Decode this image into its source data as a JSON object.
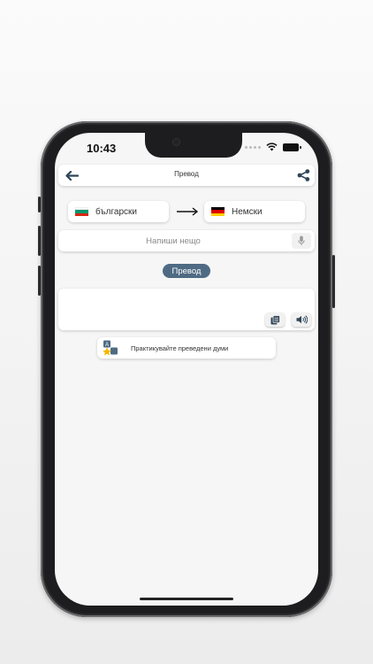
{
  "status_bar": {
    "time": "10:43",
    "icons": [
      "signal-dots-icon",
      "wifi-icon",
      "battery-icon"
    ]
  },
  "toolbar": {
    "title": "Превод",
    "back_icon": "arrow-left-icon",
    "share_icon": "share-icon"
  },
  "languages": {
    "source": {
      "name": "български",
      "flag": "bulgaria-flag-icon"
    },
    "arrow_icon": "arrow-right-icon",
    "target": {
      "name": "Немски",
      "flag": "germany-flag-icon"
    }
  },
  "input": {
    "value": "",
    "placeholder": "Напиши нещо",
    "mic_icon": "microphone-icon"
  },
  "translate_button": {
    "label": "Превод"
  },
  "output": {
    "text": "",
    "copy_icon": "copy-icon",
    "speaker_icon": "speaker-icon"
  },
  "practice": {
    "label": "Практикувайте преведени думи",
    "icon": "flashcards-star-icon"
  },
  "colors": {
    "accent": "#4f6b84",
    "background": "#f6f6f6",
    "card": "#ffffff"
  }
}
